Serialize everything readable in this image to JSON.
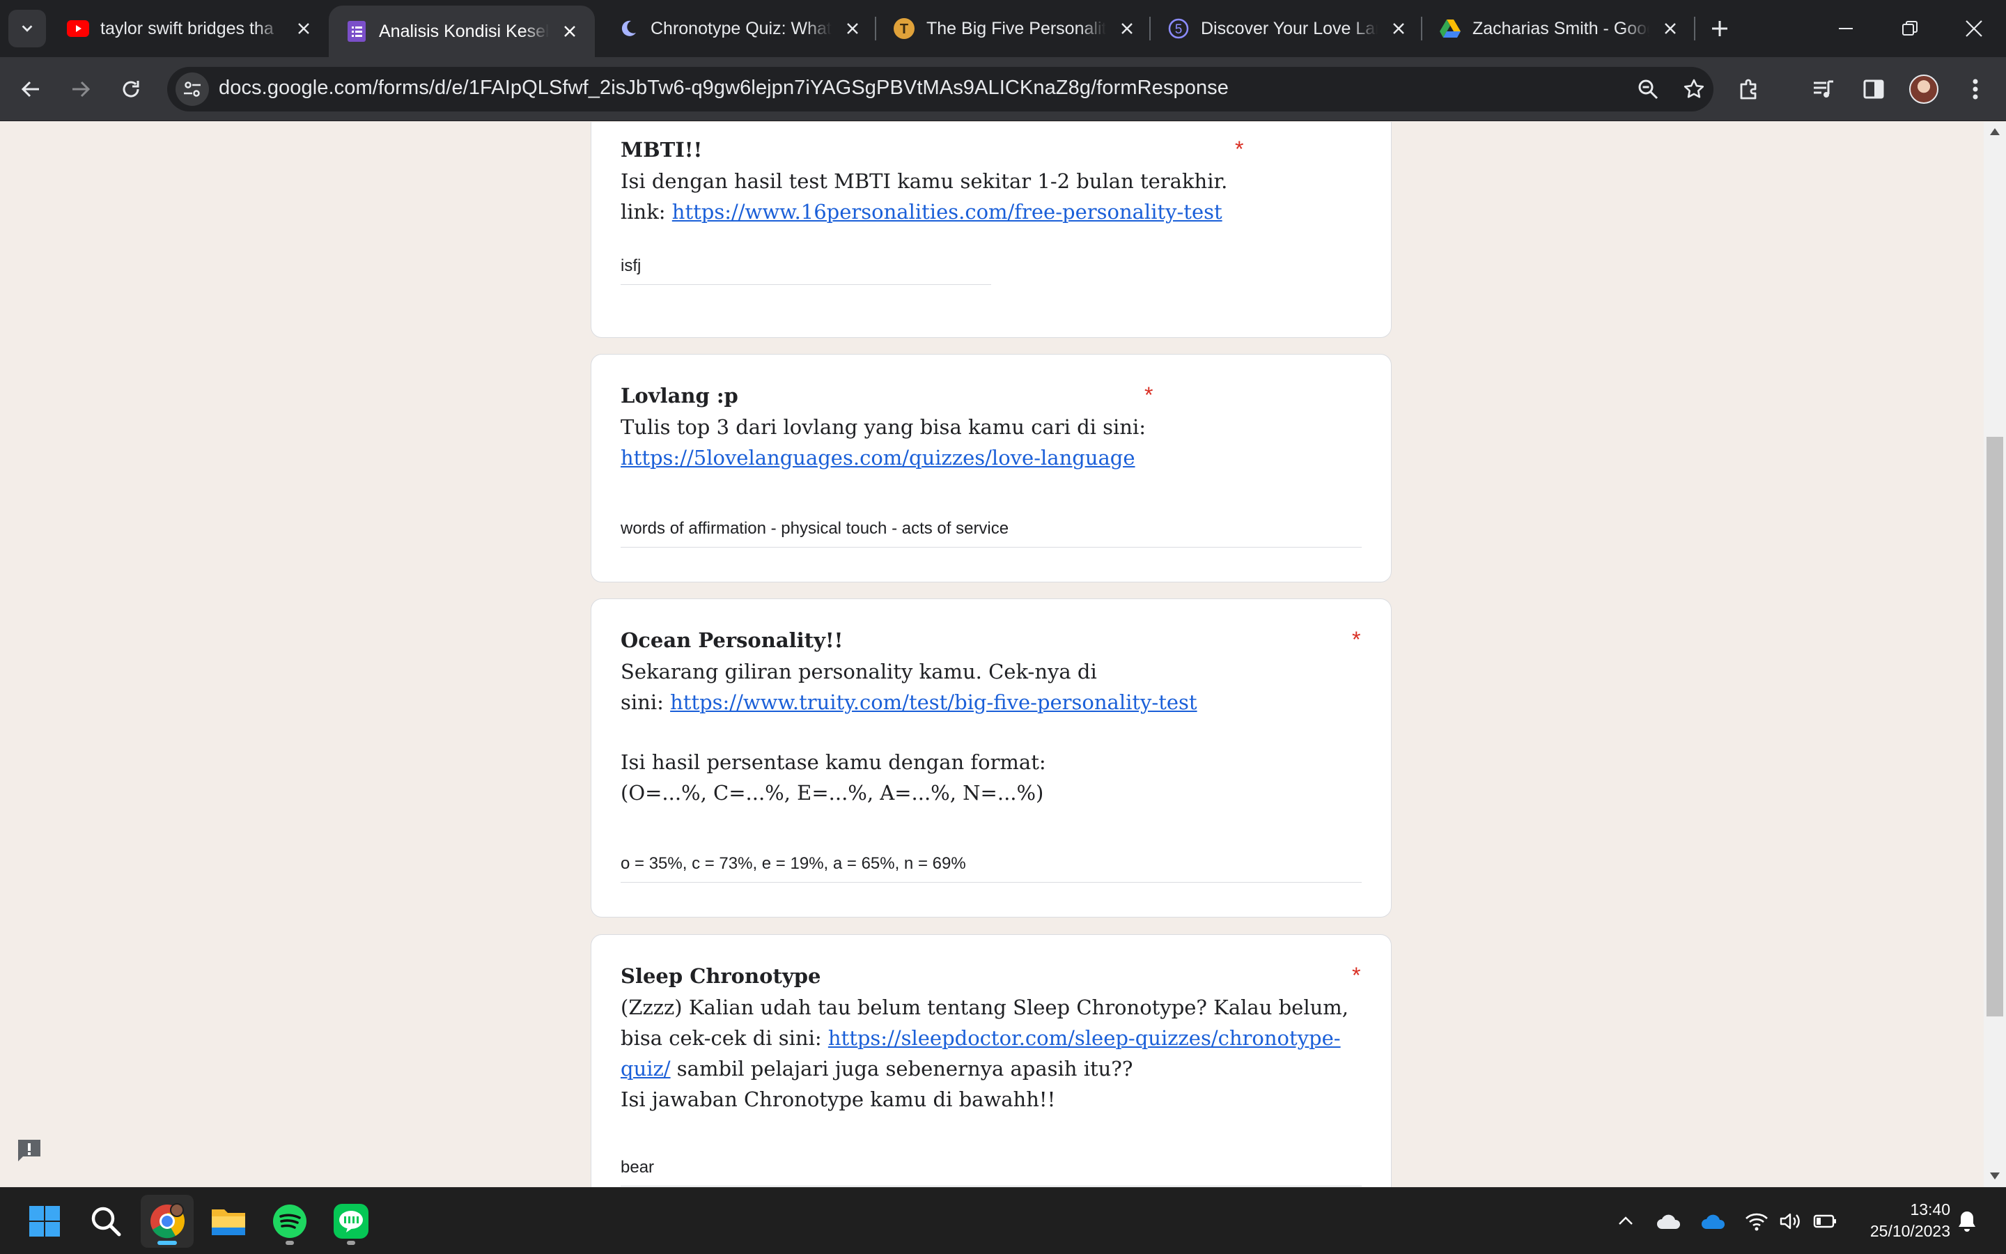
{
  "browser": {
    "tabs": [
      {
        "title": "taylor swift bridges tha",
        "icon": "youtube-icon"
      },
      {
        "title": "Analisis Kondisi Keseha",
        "icon": "google-forms-icon",
        "active": true
      },
      {
        "title": "Chronotype Quiz: What",
        "icon": "moon-icon"
      },
      {
        "title": "The Big Five Personality",
        "icon": "truity-icon",
        "icon_text": "T"
      },
      {
        "title": "Discover Your Love Lan",
        "icon": "five-love-languages-icon",
        "icon_text": "5"
      },
      {
        "title": "Zacharias Smith - Goog",
        "icon": "google-drive-icon"
      }
    ],
    "url": "docs.google.com/forms/d/e/1FAIpQLSfwf_2isJbTw6-q9gw6lejpn7iYAGSgPBVtMAs9ALICKnaZ8g/formResponse"
  },
  "form": {
    "questions": [
      {
        "title": "MBTI!!",
        "required_mark": "*",
        "desc_line1": "Isi dengan hasil test MBTI kamu sekitar 1-2 bulan terakhir.",
        "desc_link_prefix": "link: ",
        "link": "https://www.16personalities.com/free-personality-test",
        "answer": "isfj"
      },
      {
        "title": "Lovlang :p",
        "required_mark": "*",
        "desc_line1": "Tulis top 3 dari lovlang yang bisa kamu cari di sini:",
        "link": "https://5lovelanguages.com/quizzes/love-language",
        "answer": "words of affirmation - physical touch - acts of service"
      },
      {
        "title": "Ocean Personality!!",
        "required_mark": "*",
        "desc_line1": "Sekarang giliran personality kamu. Cek-nya di",
        "desc_link_prefix": "sini: ",
        "link": "https://www.truity.com/test/big-five-personality-test",
        "desc_line3": "Isi hasil persentase kamu dengan format:",
        "desc_line4": "(O=...%, C=...%, E=...%, A=...%, N=...%)",
        "answer": "o = 35%, c = 73%, e = 19%, a = 65%, n = 69%"
      },
      {
        "title": "Sleep Chronotype",
        "required_mark": "*",
        "desc_line1": "(Zzzz) Kalian udah tau belum tentang Sleep Chronotype? Kalau belum,",
        "desc_link_prefix": "bisa cek-cek di sini: ",
        "link": "https://sleepdoctor.com/sleep-quizzes/chronotype-quiz/",
        "link_part1": "https://sleepdoctor.com/sleep-quizzes/chronotype-",
        "link_part2": "quiz/",
        "desc_link_suffix": " sambil pelajari juga sebenernya apasih itu??",
        "desc_line4": "Isi jawaban Chronotype kamu di bawahh!!",
        "answer": "bear"
      }
    ]
  },
  "taskbar": {
    "apps": [
      "start-icon",
      "search-icon",
      "chrome-icon",
      "file-explorer-icon",
      "spotify-icon",
      "line-icon"
    ],
    "time": "13:40",
    "date": "25/10/2023"
  },
  "colors": {
    "page_background": "#f3ede8",
    "link": "#1a5fd8",
    "required": "#d93025",
    "tab_strip": "#202124",
    "toolbar": "#35363a"
  }
}
